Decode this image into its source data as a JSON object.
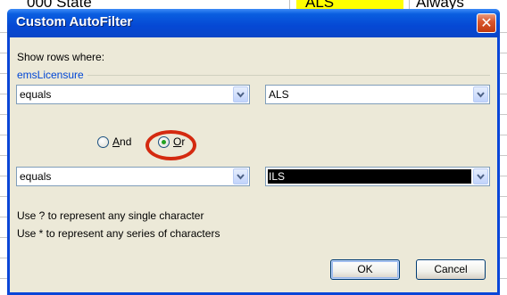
{
  "background_sheet": {
    "cells": [
      "000 State",
      "ALS",
      "Always"
    ]
  },
  "dialog": {
    "title": "Custom AutoFilter",
    "close_glyph": "✕",
    "show_rows_label": "Show rows where:",
    "field_name": "emsLicensure",
    "criteria1": {
      "operator": "equals",
      "value": "ALS"
    },
    "logic": {
      "and_label_key": "A",
      "and_label_rest": "nd",
      "or_label_key": "O",
      "or_label_rest": "r",
      "selected": "Or"
    },
    "criteria2": {
      "operator": "equals",
      "value": "ILS"
    },
    "hint1": "Use ? to represent any single character",
    "hint2": "Use * to represent any series of characters",
    "ok_label": "OK",
    "cancel_label": "Cancel"
  },
  "colors": {
    "title_bar": "#0548d4",
    "close_button": "#d9572e",
    "client_bg": "#ece9d8",
    "group_title": "#0046d5",
    "annotation_circle": "#d42a10",
    "highlight_cell": "#ffff00"
  },
  "icons": {
    "close": "close-icon",
    "dropdown": "chevron-down-icon"
  }
}
